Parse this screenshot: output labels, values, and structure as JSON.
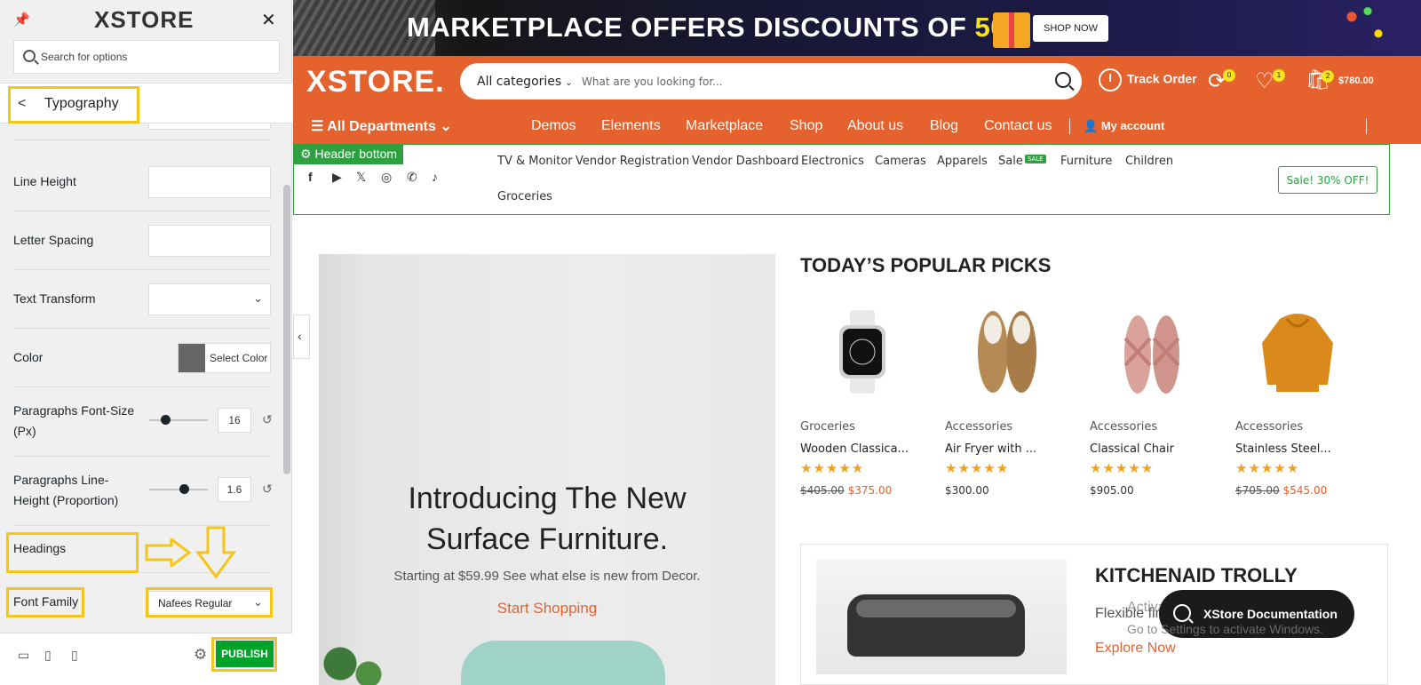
{
  "sidebar": {
    "brand": "XSTORE",
    "search_placeholder": "Search for options",
    "section_title": "Typography",
    "fields": {
      "line_height": "Line Height",
      "letter_spacing": "Letter Spacing",
      "text_transform": "Text Transform",
      "color": "Color",
      "select_color": "Select Color",
      "paragraph_font_size": "Paragraphs Font-Size (Px)",
      "paragraph_font_size_value": "16",
      "paragraph_line_height": "Paragraphs Line-Height (Proportion)",
      "paragraph_line_height_value": "1.6",
      "headings": "Headings",
      "font_family": "Font Family",
      "font_family_value": "Nafees Regular"
    },
    "publish_label": "PUBLISH"
  },
  "preview": {
    "banner": {
      "text": "MARKETPLACE OFFERS DISCOUNTS OF ",
      "percent": "50%",
      "button": "SHOP NOW"
    },
    "header": {
      "brand": "XSTORE.",
      "category": "All categories",
      "search_placeholder": "What are you looking for...",
      "track_order": "Track Order",
      "compare_count": "0",
      "wishlist_count": "1",
      "cart_count": "2",
      "cart_total": "$780.00",
      "all_departments": "All Departments",
      "nav": [
        "Demos",
        "Elements",
        "Marketplace",
        "Shop",
        "About us",
        "Blog",
        "Contact us"
      ],
      "account": "My account"
    },
    "header_bottom": {
      "tag": "Header bottom",
      "links": [
        "TV & Monitor",
        "Vendor Registration",
        "Vendor Dashboard",
        "Electronics",
        "Cameras",
        "Apparels",
        "Sale",
        "Furniture",
        "Children",
        "Groceries"
      ],
      "sale_badge": "SALE",
      "sale_button": "Sale! 30% OFF!"
    },
    "hero": {
      "heading_line1": "Introducing The New",
      "heading_line2": "Surface Furniture.",
      "subtext": "Starting at $59.99 See what else is new from Decor.",
      "cta": "Start Shopping"
    },
    "popular": {
      "title": "TODAY’S POPULAR PICKS",
      "products": [
        {
          "category": "Groceries",
          "name": "Wooden Classica...",
          "old_price": "$405.00",
          "price": "$375.00"
        },
        {
          "category": "Accessories",
          "name": "Air Fryer with ...",
          "old_price": "",
          "price": "$300.00"
        },
        {
          "category": "Accessories",
          "name": "Classical Chair",
          "old_price": "",
          "price": "$905.00"
        },
        {
          "category": "Accessories",
          "name": "Stainless Steel...",
          "old_price": "$705.00",
          "price": "$545.00"
        }
      ],
      "stars": "★★★★★"
    },
    "kitchen": {
      "title": "KITCHENAID TROLLY",
      "text": "Flexible fir",
      "cta": "Explore Now"
    },
    "doc_button": "XStore Documentation",
    "watermark_line1": "Activate Windows",
    "watermark_line2": "Go to Settings to activate Windows."
  },
  "colors": {
    "accent": "#e5612d",
    "publish": "#00a32a",
    "highlight": "#f5c518",
    "header_bottom": "#2ea03f"
  }
}
